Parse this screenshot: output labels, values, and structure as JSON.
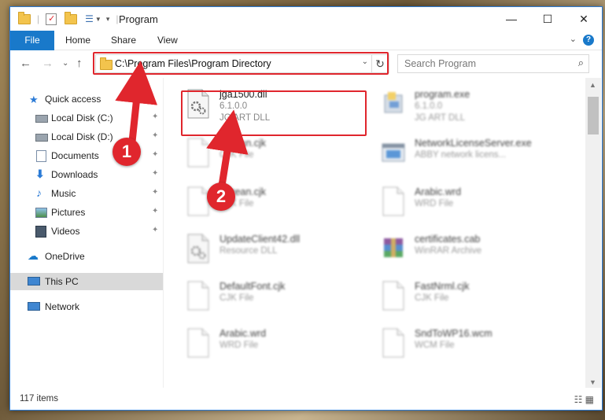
{
  "window": {
    "title": "Program",
    "controls": {
      "minimize": "—",
      "maximize": "☐",
      "close": "✕"
    }
  },
  "ribbon": {
    "tabs": [
      "File",
      "Home",
      "Share",
      "View"
    ],
    "help": "?",
    "expand": "⌄"
  },
  "navigation": {
    "back": "←",
    "forward": "→",
    "recent": "⌄",
    "up": "↑",
    "address": "C:\\Program Files\\Program Directory",
    "address_dropdown": "⌄",
    "refresh": "↻",
    "search_placeholder": "Search Program",
    "search_icon": "⌕"
  },
  "sidebar": {
    "items": [
      {
        "label": "Quick access",
        "icon": "star-icon",
        "pinned": false
      },
      {
        "label": "Local Disk (C:)",
        "icon": "drive-icon",
        "pinned": true
      },
      {
        "label": "Local Disk (D:)",
        "icon": "drive-icon",
        "pinned": true
      },
      {
        "label": "Documents",
        "icon": "documents-icon",
        "pinned": true
      },
      {
        "label": "Downloads",
        "icon": "download-icon",
        "pinned": true
      },
      {
        "label": "Music",
        "icon": "music-icon",
        "pinned": true
      },
      {
        "label": "Pictures",
        "icon": "pictures-icon",
        "pinned": true
      },
      {
        "label": "Videos",
        "icon": "videos-icon",
        "pinned": true
      },
      {
        "label": "OneDrive",
        "icon": "cloud-icon",
        "pinned": false
      },
      {
        "label": "This PC",
        "icon": "computer-icon",
        "pinned": false,
        "selected": true
      },
      {
        "label": "Network",
        "icon": "network-icon",
        "pinned": false
      }
    ],
    "pin_glyph": "📌"
  },
  "files": [
    {
      "name": "jga1500.dll",
      "line1": "6.1.0.0",
      "line2": "JG ART DLL",
      "icon": "dll-gear-icon",
      "focused": true
    },
    {
      "name": "program.exe",
      "line1": "6.1.0.0",
      "line2": "JG ART DLL",
      "icon": "exe-icon"
    },
    {
      "name": "Korean.cjk",
      "line1": "CJK File",
      "icon": "blank-file-icon"
    },
    {
      "name": "NetworkLicenseServer.exe",
      "line1": "ABBY network licens...",
      "icon": "exe-window-icon"
    },
    {
      "name": "Korean.cjk",
      "line1": "CJK File",
      "icon": "blank-file-icon"
    },
    {
      "name": "Arabic.wrd",
      "line1": "WRD File",
      "icon": "blank-file-icon"
    },
    {
      "name": "UpdateClient42.dll",
      "line1": "Resource DLL",
      "icon": "dll-gear-icon"
    },
    {
      "name": "certificates.cab",
      "line1": "WinRAR Archive",
      "icon": "winrar-icon"
    },
    {
      "name": "DefaultFont.cjk",
      "line1": "CJK File",
      "icon": "blank-file-icon"
    },
    {
      "name": "FastNrml.cjk",
      "line1": "CJK File",
      "icon": "blank-file-icon"
    },
    {
      "name": "Arabic.wrd",
      "line1": "WRD File",
      "icon": "blank-file-icon"
    },
    {
      "name": "SndToWP16.wcm",
      "line1": "WCM File",
      "icon": "blank-file-icon"
    }
  ],
  "status": {
    "count": "117 items",
    "views": "☷ ▦"
  },
  "annotations": {
    "step1": "1",
    "step2": "2"
  },
  "colors": {
    "accent": "#1979ca",
    "highlight": "#e0262d"
  }
}
